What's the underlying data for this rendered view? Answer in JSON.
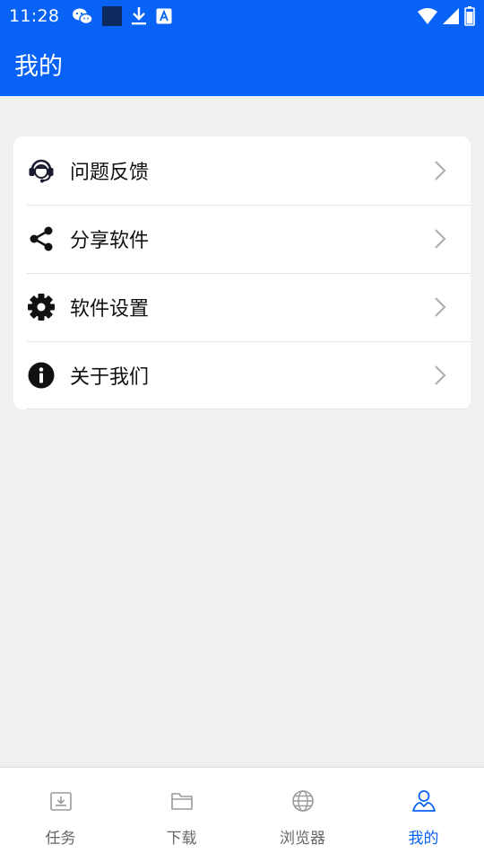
{
  "status_bar": {
    "time": "11:28",
    "left_icons": [
      "wechat-icon",
      "app-square-icon",
      "download-icon",
      "font-a-icon"
    ],
    "right_icons": [
      "wifi-icon",
      "signal-icon",
      "battery-icon"
    ]
  },
  "header": {
    "title": "我的"
  },
  "menu": {
    "items": [
      {
        "label": "问题反馈",
        "icon": "headset-icon"
      },
      {
        "label": "分享软件",
        "icon": "share-icon"
      },
      {
        "label": "软件设置",
        "icon": "gear-icon"
      },
      {
        "label": "关于我们",
        "icon": "info-icon"
      }
    ]
  },
  "bottom_nav": {
    "items": [
      {
        "label": "任务",
        "icon": "tray-download-icon"
      },
      {
        "label": "下载",
        "icon": "folder-icon"
      },
      {
        "label": "浏览器",
        "icon": "globe-icon"
      },
      {
        "label": "我的",
        "icon": "person-icon"
      }
    ],
    "active_index": 3
  },
  "colors": {
    "primary": "#0862f5",
    "background": "#f0f0f0",
    "inactive_nav": "#666666",
    "inactive_nav_icon": "#9a9a9a"
  }
}
